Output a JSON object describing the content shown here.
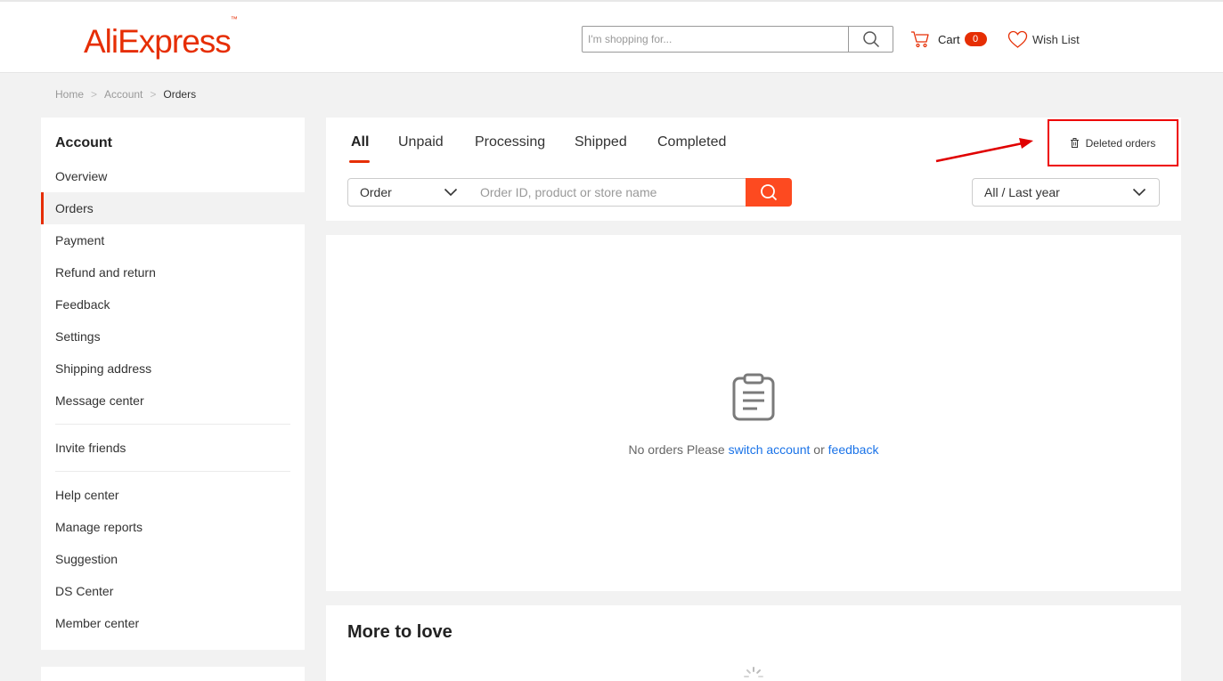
{
  "header": {
    "logo_text": "AliExpress",
    "logo_tm": "™",
    "search_placeholder": "I'm shopping for...",
    "cart_label": "Cart",
    "cart_count": "0",
    "wishlist_label": "Wish List",
    "accent_color": "#e62e04"
  },
  "breadcrumb": {
    "items": [
      "Home",
      "Account",
      "Orders"
    ],
    "separator": ">"
  },
  "sidebar": {
    "title": "Account",
    "items": [
      {
        "label": "Overview"
      },
      {
        "label": "Orders",
        "active": true
      },
      {
        "label": "Payment"
      },
      {
        "label": "Refund and return"
      },
      {
        "label": "Feedback"
      },
      {
        "label": "Settings"
      },
      {
        "label": "Shipping address"
      },
      {
        "label": "Message center"
      },
      {
        "label": "Invite friends"
      },
      {
        "label": "Help center"
      },
      {
        "label": "Manage reports"
      },
      {
        "label": "Suggestion"
      },
      {
        "label": "DS Center"
      },
      {
        "label": "Member center"
      }
    ]
  },
  "orders": {
    "tabs": [
      "All",
      "Unpaid",
      "Processing",
      "Shipped",
      "Completed"
    ],
    "active_tab": "All",
    "deleted_orders_label": "Deleted orders",
    "filter_type": "Order",
    "search_placeholder": "Order ID, product or store name",
    "time_filter": "All / Last year",
    "search_button_color": "#fd4a20"
  },
  "empty_state": {
    "text": "No orders Please ",
    "link_switch": "switch account",
    "or_text": " or ",
    "link_feedback": "feedback",
    "icon": "clipboard-icon"
  },
  "more_to_love": {
    "title": "More to love"
  },
  "annotation": {
    "highlight_color": "#e00000"
  }
}
